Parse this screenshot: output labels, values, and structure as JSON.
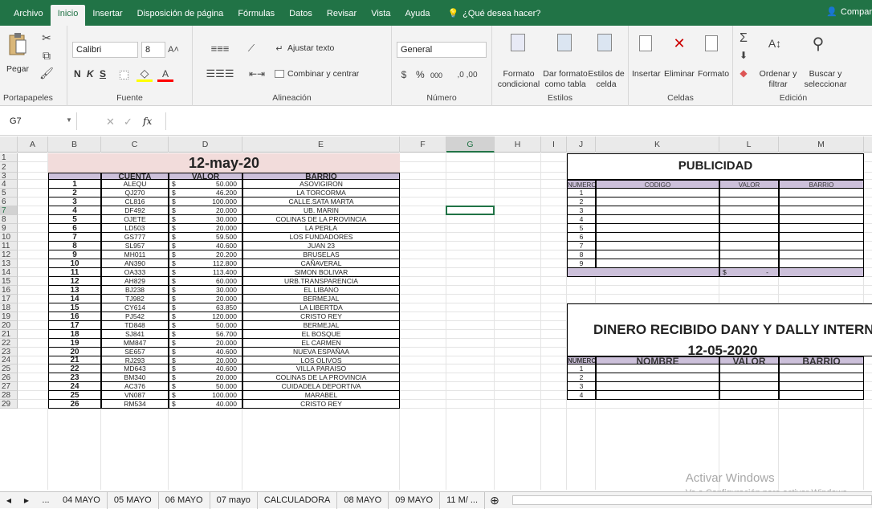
{
  "menu": {
    "tabs": [
      "Archivo",
      "Inicio",
      "Insertar",
      "Disposición de página",
      "Fórmulas",
      "Datos",
      "Revisar",
      "Vista",
      "Ayuda"
    ],
    "active": "Inicio",
    "tell": "¿Qué desea hacer?",
    "share": "Compar"
  },
  "ribbon": {
    "paste": "Pegar",
    "clipboard": "Portapapeles",
    "font_name": "Calibri",
    "font_size": "8",
    "bold": "N",
    "italic": "K",
    "underline": "S",
    "font_group": "Fuente",
    "wrap": "Ajustar texto",
    "merge": "Combinar y centrar",
    "align_group": "Alineación",
    "number_format": "General",
    "number_group": "Número",
    "pct": "%",
    "thousands": "000",
    "cond_format": [
      "Formato",
      "condicional"
    ],
    "table_format": [
      "Dar formato",
      "como tabla"
    ],
    "cell_styles": [
      "Estilos de",
      "celda"
    ],
    "styles_group": "Estilos",
    "insert": "Insertar",
    "delete": "Eliminar",
    "format": "Formato",
    "cells_group": "Celdas",
    "sort": [
      "Ordenar y",
      "filtrar"
    ],
    "find": [
      "Buscar y",
      "seleccionar"
    ],
    "edit_group": "Edición"
  },
  "formula_bar": {
    "name_box": "G7",
    "fx": "fx",
    "value": ""
  },
  "columns": [
    "A",
    "B",
    "C",
    "D",
    "E",
    "F",
    "G",
    "H",
    "I",
    "J",
    "K",
    "L",
    "M"
  ],
  "rows": [
    "1",
    "2",
    "3",
    "4",
    "5",
    "6",
    "7",
    "8",
    "9",
    "10",
    "11",
    "12",
    "13",
    "14",
    "15",
    "16",
    "17",
    "18",
    "19",
    "20",
    "21",
    "22",
    "23",
    "24",
    "25",
    "26",
    "27",
    "28",
    "29"
  ],
  "selected_col": "G",
  "selected_row": "7",
  "main_table": {
    "title": "12-may-20",
    "headers": [
      "CUENTA",
      "VALOR",
      "BARRIO"
    ],
    "currency": "$",
    "rows": [
      [
        "1",
        "ALEQU",
        "50.000",
        "ASOVIGIRON"
      ],
      [
        "2",
        "QJ270",
        "46.200",
        "LA TORCORMA"
      ],
      [
        "3",
        "CL816",
        "100.000",
        "CALLE.SATA MARTA"
      ],
      [
        "4",
        "DF492",
        "20.000",
        "UB. MARIN"
      ],
      [
        "5",
        "OJETE",
        "30.000",
        "COLINAS DE LA PROVINCIA"
      ],
      [
        "6",
        "LD503",
        "20.000",
        "LA PERLA"
      ],
      [
        "7",
        "GS777",
        "59.500",
        "LOS FUNDADORES"
      ],
      [
        "8",
        "SL957",
        "40.600",
        "JUAN 23"
      ],
      [
        "9",
        "MH011",
        "20.200",
        "BRUSELAS"
      ],
      [
        "10",
        "AN390",
        "112.800",
        "CAÑAVERAL"
      ],
      [
        "11",
        "OA333",
        "113.400",
        "SIMON BOLIVAR"
      ],
      [
        "12",
        "AH829",
        "60.000",
        "URB.TRANSPARENCIA"
      ],
      [
        "13",
        "BJ238",
        "30.000",
        "EL LIBANO"
      ],
      [
        "14",
        "TJ982",
        "20.000",
        "BERMEJAL"
      ],
      [
        "15",
        "CY614",
        "63.850",
        "LA LIBERTDA"
      ],
      [
        "16",
        "PJ542",
        "120.000",
        "CRISTO REY"
      ],
      [
        "17",
        "TD848",
        "50.000",
        "BERMEJAL"
      ],
      [
        "18",
        "SJ841",
        "56.700",
        "EL BOSQUE"
      ],
      [
        "19",
        "MM847",
        "20.000",
        "EL CARMEN"
      ],
      [
        "20",
        "SE657",
        "40.600",
        "NUEVA ESPAÑAA"
      ],
      [
        "21",
        "RJ293",
        "20.000",
        "LOS OLIVOS"
      ],
      [
        "22",
        "MD643",
        "40.600",
        "VILLA PARAISO"
      ],
      [
        "23",
        "BM340",
        "20.000",
        "COLINAS DE LA PROVINCIA"
      ],
      [
        "24",
        "AC376",
        "50.000",
        "CUIDADELA DEPORTIVA"
      ],
      [
        "25",
        "VN087",
        "100.000",
        "MARABEL"
      ],
      [
        "26",
        "RM534",
        "40.000",
        "CRISTO REY"
      ]
    ]
  },
  "publicidad": {
    "title": "PUBLICIDAD",
    "headers": [
      "NUMERO",
      "CODIGO",
      "VALOR",
      "BARRIO"
    ],
    "numbers": [
      "1",
      "2",
      "3",
      "4",
      "5",
      "6",
      "7",
      "8",
      "9"
    ],
    "total_currency": "$",
    "total_value": "-"
  },
  "dinero": {
    "title": "DINERO RECIBIDO DANY Y DALLY INTERNI",
    "date": "12-05-2020",
    "headers": [
      "NUMERO",
      "NOMBRE",
      "VALOR",
      "BARRIO"
    ],
    "numbers": [
      "1",
      "2",
      "3",
      "4"
    ]
  },
  "sheets": [
    "04 MAYO",
    "05 MAYO",
    "06 MAYO",
    "07 mayo",
    "CALCULADORA",
    "08 MAYO",
    "09 MAYO",
    "11 M/ ..."
  ],
  "sheet_nav": {
    "prev": "◀",
    "next": "▶",
    "more": "..."
  },
  "watermark": {
    "line1": "Activar Windows",
    "line2": "Ve a Configuración para activar Windows."
  },
  "colors": {
    "excel_green": "#217346",
    "title_fill": "#f2dcdb",
    "header_fill": "#ccc0da"
  }
}
